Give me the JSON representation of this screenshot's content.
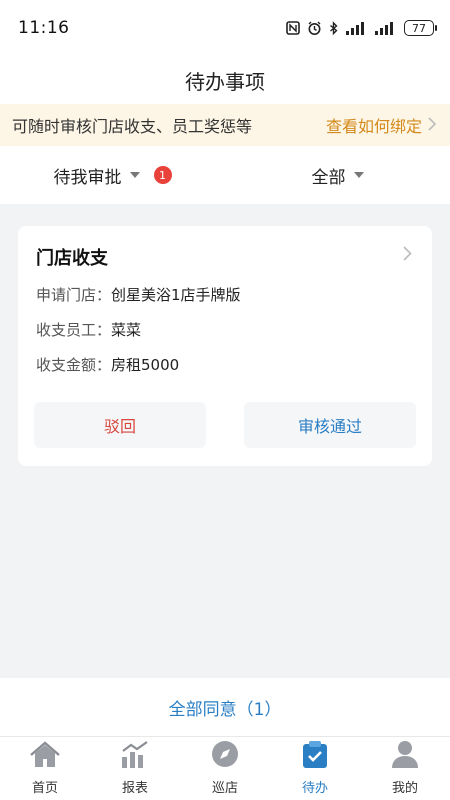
{
  "status_bar": {
    "time": "11:16",
    "battery": "77"
  },
  "header": {
    "title": "待办事项"
  },
  "notice": {
    "text": "可随时审核门店收支、员工奖惩等",
    "link": "查看如何绑定"
  },
  "filters": {
    "pending": {
      "label": "待我审批",
      "badge": "1"
    },
    "scope": {
      "label": "全部"
    }
  },
  "card": {
    "title": "门店收支",
    "rows": [
      {
        "label": "申请门店：",
        "value": "创星美浴1店手牌版"
      },
      {
        "label": "收支员工：",
        "value": "菜菜"
      },
      {
        "label": "收支金额：",
        "value": "房租5000"
      }
    ],
    "reject_label": "驳回",
    "approve_label": "审核通过"
  },
  "approve_all": {
    "label": "全部同意（1）"
  },
  "nav": {
    "items": [
      {
        "label": "首页",
        "icon": "home-icon"
      },
      {
        "label": "报表",
        "icon": "report-icon"
      },
      {
        "label": "巡店",
        "icon": "compass-icon"
      },
      {
        "label": "待办",
        "icon": "todo-icon"
      },
      {
        "label": "我的",
        "icon": "user-icon"
      }
    ],
    "active_index": 3
  },
  "colors": {
    "accent": "#2a7fc4",
    "danger": "#d9463e",
    "notice_bg": "#fdf6e6",
    "notice_link": "#d48a1c",
    "badge": "#e8423a"
  }
}
